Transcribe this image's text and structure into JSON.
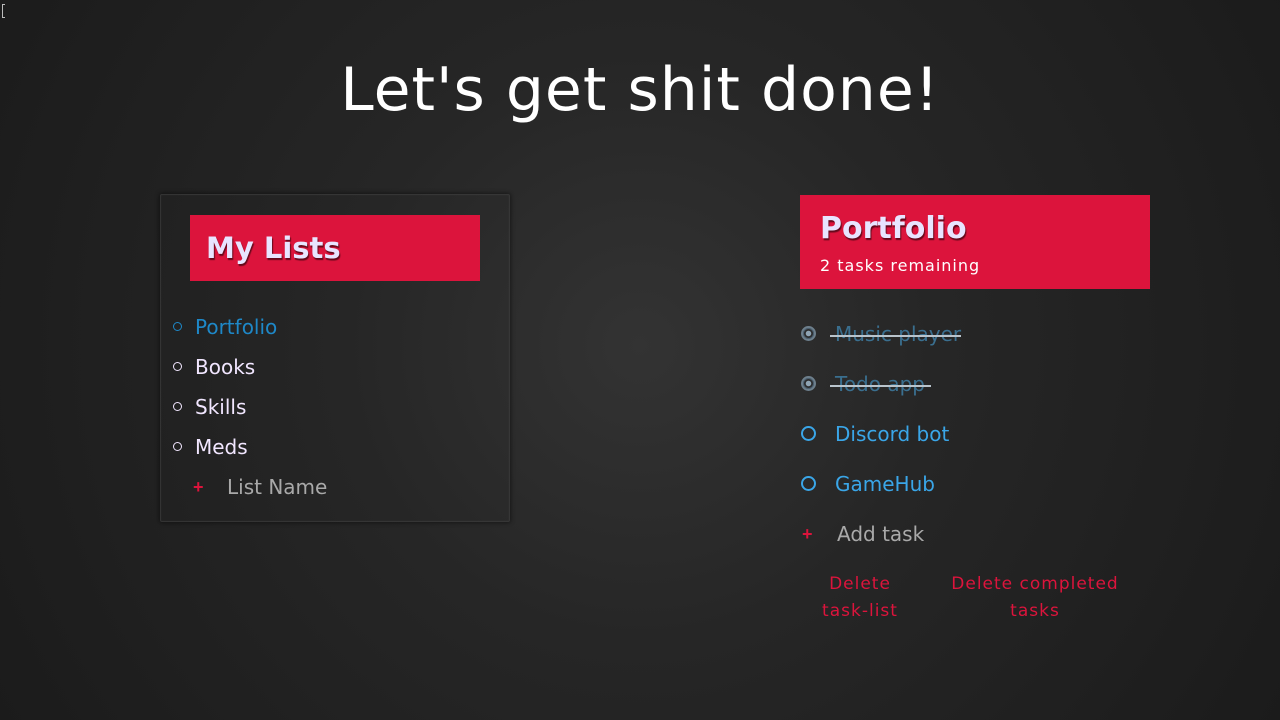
{
  "page": {
    "title": "Let's get shit done!"
  },
  "lists_panel": {
    "title": "My Lists",
    "items": [
      {
        "label": "Portfolio",
        "active": true
      },
      {
        "label": "Books",
        "active": false
      },
      {
        "label": "Skills",
        "active": false
      },
      {
        "label": "Meds",
        "active": false
      }
    ],
    "new_list": {
      "placeholder": "List Name",
      "value": ""
    }
  },
  "todo_panel": {
    "title": "Portfolio",
    "remaining": "2 tasks remaining",
    "tasks": [
      {
        "label": "Music player",
        "completed": true
      },
      {
        "label": "Todo app",
        "completed": true
      },
      {
        "label": "Discord bot",
        "completed": false
      },
      {
        "label": "GameHub",
        "completed": false
      }
    ],
    "new_task": {
      "placeholder": "Add task",
      "value": ""
    },
    "actions": {
      "delete_list": "Delete task-list",
      "delete_completed": "Delete completed tasks"
    }
  },
  "colors": {
    "accent": "#dc143c",
    "active_list": "#1e88c8",
    "task": "#3aa6e8",
    "background": "#262626"
  },
  "icons": {
    "bullet": "circle-bullet-icon",
    "add": "plus-icon",
    "checkbox": "circle-checkbox-icon"
  }
}
